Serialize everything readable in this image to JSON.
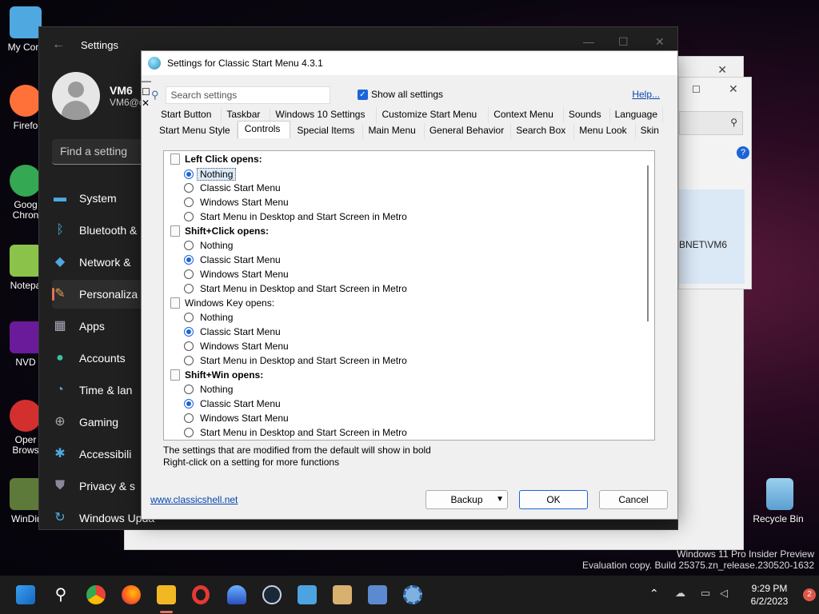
{
  "desktop": {
    "icons": [
      {
        "label": "My Com",
        "color": "#4fa8e0"
      },
      {
        "label": "Firefo",
        "color": "#ff7139"
      },
      {
        "label": "Goog Chron",
        "color": "#34a853"
      },
      {
        "label": "Notepa",
        "color": "#8bc34a"
      },
      {
        "label": "NVD",
        "color": "#6a1b9a"
      },
      {
        "label": "Oper Brows",
        "color": "#d32f2f"
      },
      {
        "label": "WinDir",
        "color": "#5d7a3a"
      }
    ],
    "recycle_bin": "Recycle Bin",
    "watermark_line1": "Windows 11 Pro Insider Preview",
    "watermark_line2": "Evaluation copy. Build 25375.zn_release.230520-1632"
  },
  "settings_window": {
    "title": "Settings",
    "user_name": "VM6",
    "user_email": "VM6@c",
    "find_placeholder": "Find a setting",
    "nav": [
      {
        "label": "System",
        "icon": "monitor-icon"
      },
      {
        "label": "Bluetooth &",
        "icon": "bluetooth-icon"
      },
      {
        "label": "Network &",
        "icon": "wifi-icon"
      },
      {
        "label": "Personaliza",
        "icon": "brush-icon"
      },
      {
        "label": "Apps",
        "icon": "apps-icon"
      },
      {
        "label": "Accounts",
        "icon": "person-icon"
      },
      {
        "label": "Time & lan",
        "icon": "clock-icon"
      },
      {
        "label": "Gaming",
        "icon": "controller-icon"
      },
      {
        "label": "Accessibili",
        "icon": "accessibility-icon"
      },
      {
        "label": "Privacy & s",
        "icon": "shield-icon"
      },
      {
        "label": "Windows Upda",
        "icon": "update-icon"
      }
    ],
    "account_partial": "BNET\\VM6"
  },
  "dialog": {
    "title": "Settings for Classic Start Menu 4.3.1",
    "search_placeholder": "Search settings",
    "show_all_label": "Show all settings",
    "help_label": "Help...",
    "tabs_row1": [
      "Start Button",
      "Taskbar",
      "Windows 10 Settings",
      "Customize Start Menu",
      "Context Menu",
      "Sounds",
      "Language"
    ],
    "tabs_row2": [
      "Start Menu Style",
      "Controls",
      "Special Items",
      "Main Menu",
      "General Behavior",
      "Search Box",
      "Menu Look",
      "Skin"
    ],
    "selected_tab": "Controls",
    "groups": [
      {
        "heading": "Left Click opens:",
        "bold": true,
        "options": [
          "Nothing",
          "Classic Start Menu",
          "Windows Start Menu",
          "Start Menu in Desktop and Start Screen in Metro"
        ],
        "selected": 0
      },
      {
        "heading": "Shift+Click opens:",
        "bold": true,
        "options": [
          "Nothing",
          "Classic Start Menu",
          "Windows Start Menu",
          "Start Menu in Desktop and Start Screen in Metro"
        ],
        "selected": 1
      },
      {
        "heading": "Windows Key opens:",
        "bold": false,
        "options": [
          "Nothing",
          "Classic Start Menu",
          "Windows Start Menu",
          "Start Menu in Desktop and Start Screen in Metro"
        ],
        "selected": 1
      },
      {
        "heading": "Shift+Win opens:",
        "bold": true,
        "options": [
          "Nothing",
          "Classic Start Menu",
          "Windows Start Menu",
          "Start Menu in Desktop and Start Screen in Metro"
        ],
        "selected": 1
      }
    ],
    "note1": "The settings that are modified from the default will show in bold",
    "note2": "Right-click on a setting for more functions",
    "link": "www.classicshell.net",
    "backup_label": "Backup",
    "ok_label": "OK",
    "cancel_label": "Cancel"
  },
  "taskbar": {
    "time": "9:29 PM",
    "date": "6/2/2023",
    "notification_count": "2"
  }
}
